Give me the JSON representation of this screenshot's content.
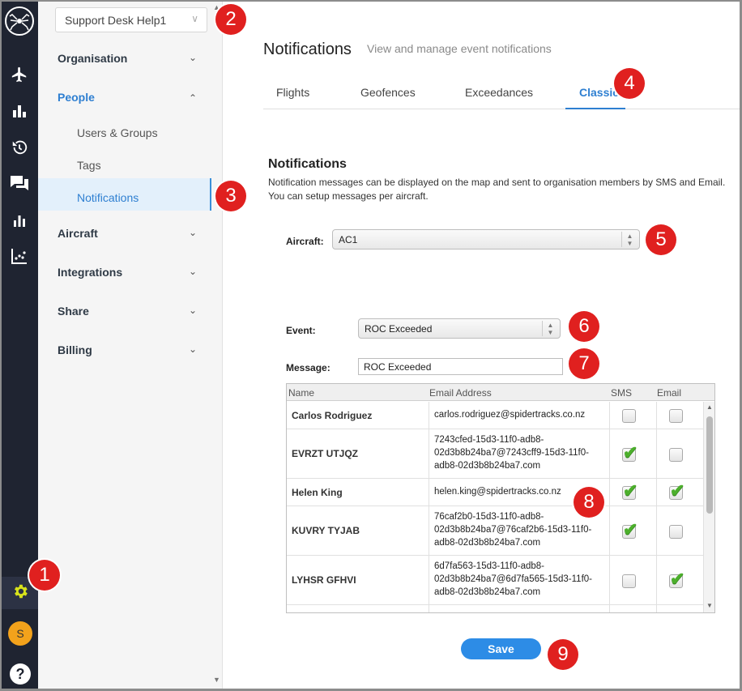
{
  "sidebar": {
    "org_selector": {
      "value": "Support Desk Help1"
    },
    "items": [
      {
        "label": "Organisation",
        "expanded": false
      },
      {
        "label": "People",
        "expanded": true,
        "children": [
          "Users & Groups",
          "Tags",
          "Notifications"
        ],
        "active_child": "Notifications"
      },
      {
        "label": "Aircraft",
        "expanded": false
      },
      {
        "label": "Integrations",
        "expanded": false
      },
      {
        "label": "Share",
        "expanded": false
      },
      {
        "label": "Billing",
        "expanded": false
      }
    ]
  },
  "rail": {
    "icons": [
      "spider-logo-icon",
      "airplane-icon",
      "bar-chart-icon",
      "history-icon",
      "chat-icon",
      "analytics-icon",
      "scatter-chart-icon",
      "gear-icon",
      "avatar",
      "help-icon"
    ],
    "avatar_initial": "S",
    "help_label": "?"
  },
  "header": {
    "title": "Notifications",
    "subtitle": "View and manage event notifications"
  },
  "tabs": [
    {
      "label": "Flights",
      "active": false
    },
    {
      "label": "Geofences",
      "active": false
    },
    {
      "label": "Exceedances",
      "active": false
    },
    {
      "label": "Classic",
      "active": true
    }
  ],
  "section": {
    "title": "Notifications",
    "description": "Notification messages can be displayed on the map and sent to organisation members by SMS and Email. You can setup messages per aircraft."
  },
  "form": {
    "aircraft_label": "Aircraft:",
    "aircraft_value": "AC1",
    "event_label": "Event:",
    "event_value": "ROC Exceeded",
    "message_label": "Message:",
    "message_value": "ROC Exceeded"
  },
  "grid": {
    "columns": [
      "Name",
      "Email Address",
      "SMS",
      "Email"
    ],
    "rows": [
      {
        "name": "Carlos Rodriguez",
        "email": "carlos.rodriguez@spidertracks.co.nz",
        "sms": false,
        "email_checked": false
      },
      {
        "name": "EVRZT UTJQZ",
        "email": "7243cfed-15d3-11f0-adb8-02d3b8b24ba7@7243cff9-15d3-11f0-adb8-02d3b8b24ba7.com",
        "sms": true,
        "email_checked": false
      },
      {
        "name": "Helen King",
        "email": "helen.king@spidertracks.co.nz",
        "sms": true,
        "email_checked": true
      },
      {
        "name": "KUVRY TYJAB",
        "email": "76caf2b0-15d3-11f0-adb8-02d3b8b24ba7@76caf2b6-15d3-11f0-adb8-02d3b8b24ba7.com",
        "sms": true,
        "email_checked": false
      },
      {
        "name": "LYHSR GFHVI",
        "email": "6d7fa563-15d3-11f0-adb8-02d3b8b24ba7@6d7fa565-15d3-11f0-adb8-02d3b8b24ba7.com",
        "sms": false,
        "email_checked": true
      }
    ]
  },
  "actions": {
    "save_label": "Save"
  },
  "callouts": [
    "1",
    "2",
    "3",
    "4",
    "5",
    "6",
    "7",
    "8",
    "9"
  ],
  "colors": {
    "accent": "#2e7fd1",
    "rail": "#1f2431",
    "callout": "#e0201f",
    "check": "#4caf2c"
  }
}
